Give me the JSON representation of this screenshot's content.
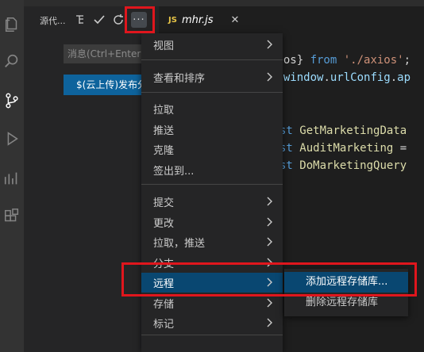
{
  "source_control": {
    "title": "源代...",
    "more_glyph": "···",
    "commit_placeholder": "消息(Ctrl+Enter 在\"",
    "commit_button_label": "$(云上传)发布分支"
  },
  "activity_icons": [
    "files-icon",
    "search-icon",
    "source-control-icon",
    "run-debug-icon",
    "remote-explorer-icon",
    "extensions-icon"
  ],
  "editor": {
    "tab": {
      "lang_badge": "JS",
      "file_name": "mhr.js",
      "close_glyph": "✕"
    },
    "code_lines": [
      {
        "tokens": [
          {
            "t": "plain",
            "v": "."
          }
        ]
      },
      {
        "tokens": [
          {
            "t": "plain",
            "v": "xios} "
          },
          {
            "t": "kw",
            "v": "from"
          },
          {
            "t": "plain",
            "v": " "
          },
          {
            "t": "str",
            "v": "'./axios'"
          },
          {
            "t": "plain",
            "v": ";"
          }
        ]
      },
      {
        "tokens": [
          {
            "t": "plain",
            "v": "= "
          },
          {
            "t": "var",
            "v": "window"
          },
          {
            "t": "plain",
            "v": "."
          },
          {
            "t": "var",
            "v": "urlConfig"
          },
          {
            "t": "plain",
            "v": "."
          },
          {
            "t": "var",
            "v": "ap"
          }
        ]
      },
      {
        "tokens": []
      },
      {
        "tokens": []
      },
      {
        "tokens": [
          {
            "t": "kw",
            "v": "st"
          },
          {
            "t": "plain",
            "v": " "
          },
          {
            "t": "fn",
            "v": "GetMarketingData"
          }
        ]
      },
      {
        "tokens": [
          {
            "t": "kw",
            "v": "st"
          },
          {
            "t": "plain",
            "v": " "
          },
          {
            "t": "fn",
            "v": "AuditMarketing"
          },
          {
            "t": "plain",
            "v": " ="
          }
        ]
      },
      {
        "tokens": [
          {
            "t": "kw",
            "v": "st"
          },
          {
            "t": "plain",
            "v": " "
          },
          {
            "t": "fn",
            "v": "DoMarketingQuery"
          }
        ]
      }
    ]
  },
  "menu": {
    "items": [
      {
        "label": "视图",
        "submenu": true
      },
      {
        "label": "查看和排序",
        "submenu": true
      },
      {
        "label": "拉取",
        "submenu": false
      },
      {
        "label": "推送",
        "submenu": false
      },
      {
        "label": "克隆",
        "submenu": false
      },
      {
        "label": "签出到...",
        "submenu": false
      },
      {
        "label": "提交",
        "submenu": true
      },
      {
        "label": "更改",
        "submenu": true
      },
      {
        "label": "拉取，推送",
        "submenu": true
      },
      {
        "label": "分支",
        "submenu": true
      },
      {
        "label": "远程",
        "submenu": true
      },
      {
        "label": "存储",
        "submenu": true
      },
      {
        "label": "标记",
        "submenu": true
      }
    ],
    "active_label": "远程"
  },
  "remote_submenu": {
    "items": [
      {
        "label": "添加远程存储库..."
      },
      {
        "label": "删除远程存储库"
      }
    ]
  },
  "colors": {
    "highlight_box": "#e0161d",
    "active_item": "#094771",
    "commit_button": "#0e639c"
  }
}
